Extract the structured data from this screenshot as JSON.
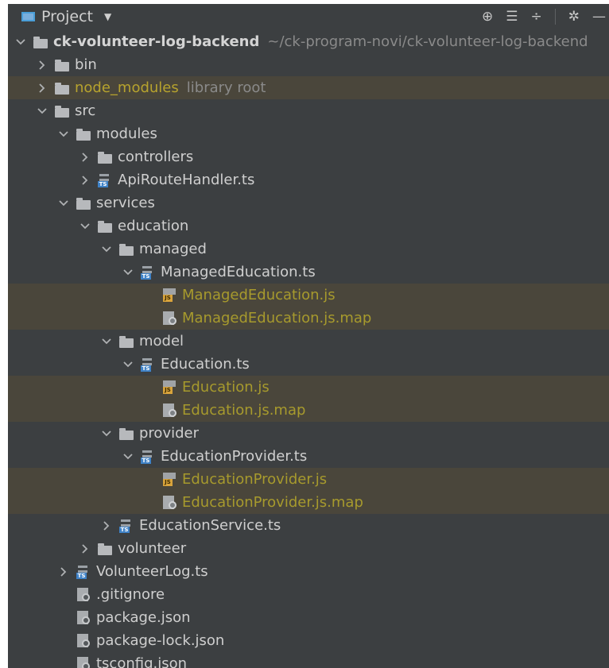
{
  "panel": {
    "title": "Project",
    "toolbar_icons": [
      "locate-icon",
      "expand-all-icon",
      "collapse-all-icon",
      "gear-icon",
      "hide-icon"
    ]
  },
  "tree": [
    {
      "depth": 0,
      "arrow": "down",
      "icon": "folder",
      "label": "ck-volunteer-log-backend",
      "hint": "~/ck-program-novi/ck-volunteer-log-backend",
      "style": "root"
    },
    {
      "depth": 1,
      "arrow": "right",
      "icon": "folder",
      "label": "bin"
    },
    {
      "depth": 1,
      "arrow": "right",
      "icon": "folder",
      "label": "node_modules",
      "hint": "library root",
      "style": "excluded",
      "highlight": true
    },
    {
      "depth": 1,
      "arrow": "down",
      "icon": "folder",
      "label": "src"
    },
    {
      "depth": 2,
      "arrow": "down",
      "icon": "folder",
      "label": "modules"
    },
    {
      "depth": 3,
      "arrow": "right",
      "icon": "folder",
      "label": "controllers"
    },
    {
      "depth": 3,
      "arrow": "right",
      "icon": "ts",
      "label": "ApiRouteHandler.ts"
    },
    {
      "depth": 2,
      "arrow": "down",
      "icon": "folder",
      "label": "services"
    },
    {
      "depth": 3,
      "arrow": "down",
      "icon": "folder",
      "label": "education"
    },
    {
      "depth": 4,
      "arrow": "down",
      "icon": "folder",
      "label": "managed"
    },
    {
      "depth": 5,
      "arrow": "down",
      "icon": "ts",
      "label": "ManagedEducation.ts"
    },
    {
      "depth": 6,
      "arrow": "none",
      "icon": "js",
      "label": "ManagedEducation.js",
      "style": "generated",
      "highlight": true
    },
    {
      "depth": 6,
      "arrow": "none",
      "icon": "map",
      "label": "ManagedEducation.js.map",
      "style": "generated",
      "highlight": true
    },
    {
      "depth": 4,
      "arrow": "down",
      "icon": "folder",
      "label": "model"
    },
    {
      "depth": 5,
      "arrow": "down",
      "icon": "ts",
      "label": "Education.ts"
    },
    {
      "depth": 6,
      "arrow": "none",
      "icon": "js",
      "label": "Education.js",
      "style": "generated",
      "highlight": true
    },
    {
      "depth": 6,
      "arrow": "none",
      "icon": "map",
      "label": "Education.js.map",
      "style": "generated",
      "highlight": true
    },
    {
      "depth": 4,
      "arrow": "down",
      "icon": "folder",
      "label": "provider"
    },
    {
      "depth": 5,
      "arrow": "down",
      "icon": "ts",
      "label": "EducationProvider.ts"
    },
    {
      "depth": 6,
      "arrow": "none",
      "icon": "js",
      "label": "EducationProvider.js",
      "style": "generated",
      "highlight": true
    },
    {
      "depth": 6,
      "arrow": "none",
      "icon": "map",
      "label": "EducationProvider.js.map",
      "style": "generated",
      "highlight": true
    },
    {
      "depth": 4,
      "arrow": "right",
      "icon": "ts",
      "label": "EducationService.ts"
    },
    {
      "depth": 3,
      "arrow": "right",
      "icon": "folder",
      "label": "volunteer"
    },
    {
      "depth": 2,
      "arrow": "right",
      "icon": "ts",
      "label": "VolunteerLog.ts"
    },
    {
      "depth": 2,
      "arrow": "none",
      "icon": "cfg",
      "label": ".gitignore"
    },
    {
      "depth": 2,
      "arrow": "none",
      "icon": "cfg",
      "label": "package.json"
    },
    {
      "depth": 2,
      "arrow": "none",
      "icon": "cfg",
      "label": "package-lock.json"
    },
    {
      "depth": 2,
      "arrow": "none",
      "icon": "cfg",
      "label": "tsconfig.json"
    }
  ],
  "colors": {
    "panel_bg": "#3c3f41",
    "highlight_row": "#4a463b",
    "excluded_text": "#b7a32e",
    "generated_text": "#a79a2d",
    "ts_badge": "#3f82c7",
    "js_badge": "#d9a43c"
  }
}
